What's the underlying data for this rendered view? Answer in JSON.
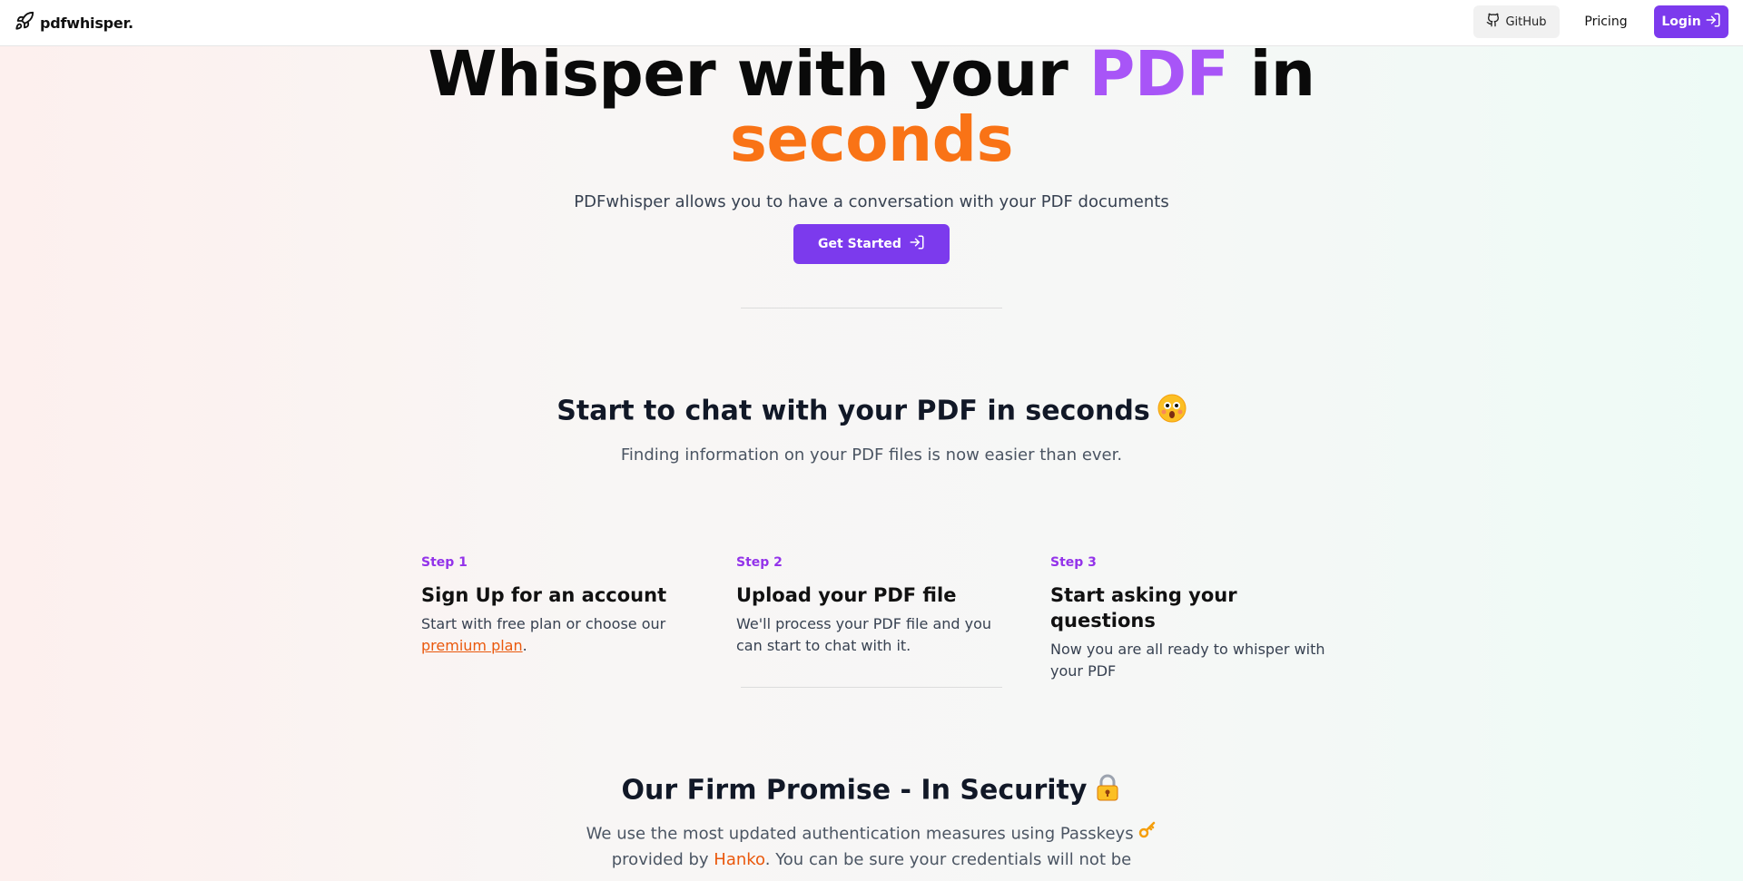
{
  "header": {
    "brand": "pdfwhisper.",
    "github_label": "GitHub",
    "pricing_label": "Pricing",
    "login_label": "Login"
  },
  "hero": {
    "title_part1": "Whisper with your ",
    "title_pdf": "PDF",
    "title_part2": " in",
    "title_line2": "seconds",
    "subtitle": "PDFwhisper allows you to have a conversation with your PDF documents",
    "cta_label": "Get Started"
  },
  "steps_section": {
    "title": "Start to chat with your PDF in seconds",
    "subtitle": "Finding information on your PDF files is now easier than ever.",
    "steps": [
      {
        "num": "Step 1",
        "title": "Sign Up for an account",
        "desc_before": "Start with free plan or choose our ",
        "link": "premium plan",
        "desc_after": "."
      },
      {
        "num": "Step 2",
        "title": "Upload your PDF file",
        "desc": "We'll process your PDF file and you can start to chat with it."
      },
      {
        "num": "Step 3",
        "title": "Start asking your questions",
        "desc": "Now you are all ready to whisper with your PDF"
      }
    ]
  },
  "security": {
    "title": "Our Firm Promise - In Security",
    "para_before": "We use the most updated authentication measures using Passkeys",
    "para_mid": "provided by ",
    "hanko": "Hanko",
    "para_after": ". You can be sure your credentials will not be"
  },
  "colors": {
    "accent": "#7c3aed",
    "purple_text": "#a855f7",
    "orange_text": "#f97316"
  }
}
